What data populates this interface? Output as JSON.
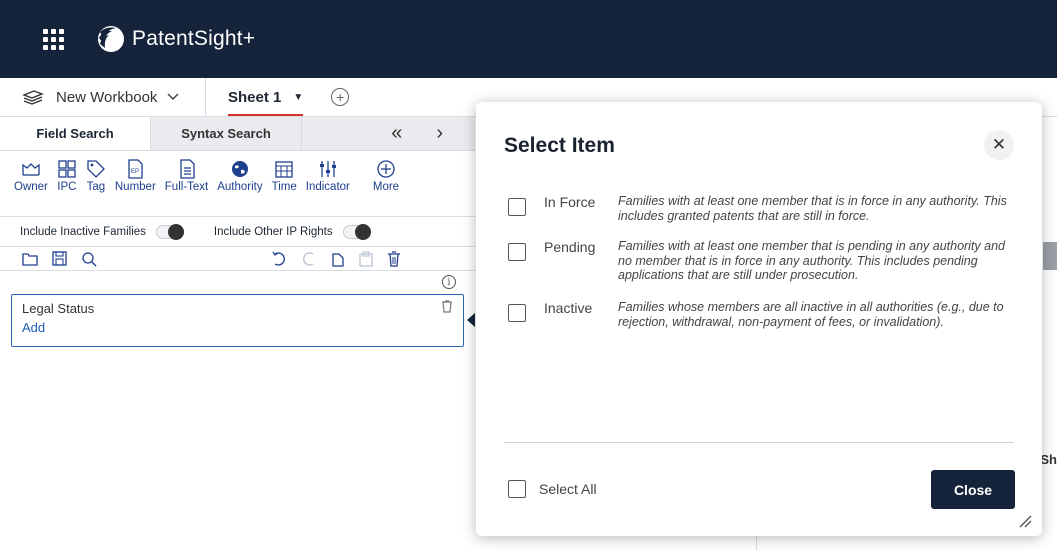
{
  "header": {
    "brand": "PatentSight+"
  },
  "workbook": {
    "name": "New Workbook",
    "sheet": "Sheet 1"
  },
  "tabs": {
    "active": "Field Search",
    "inactive": "Syntax Search"
  },
  "icons": [
    {
      "label": "Owner",
      "icon": "owner-icon"
    },
    {
      "label": "IPC",
      "icon": "ipc-icon"
    },
    {
      "label": "Tag",
      "icon": "tag-icon"
    },
    {
      "label": "Number",
      "icon": "number-icon"
    },
    {
      "label": "Full-Text",
      "icon": "fulltext-icon"
    },
    {
      "label": "Authority",
      "icon": "globe-icon"
    },
    {
      "label": "Time",
      "icon": "calendar-icon"
    },
    {
      "label": "Indicator",
      "icon": "indicator-icon"
    },
    {
      "label": "More",
      "icon": "plus-circle-icon"
    }
  ],
  "number_badge": "EP",
  "toggles": {
    "inactive": "Include Inactive Families",
    "other_ip": "Include Other IP Rights"
  },
  "legal": {
    "title": "Legal Status",
    "add": "Add"
  },
  "info_glyph": "i",
  "background": {
    "label": "Sh"
  },
  "modal": {
    "title": "Select Item",
    "options": [
      {
        "label": "In Force",
        "desc": "Families with at least one member that is in force in any authority. This includes granted patents that are still in force."
      },
      {
        "label": "Pending",
        "desc": "Families with at least one member that is pending in any authority and no member that is in force in any authority. This includes pending applications that are still under prosecution."
      },
      {
        "label": "Inactive",
        "desc": "Families whose members are all inactive in all authorities (e.g., due to rejection, withdrawal, non-payment of fees, or invalidation)."
      }
    ],
    "select_all": "Select All",
    "close": "Close"
  },
  "colors": {
    "header": "#15243a",
    "accent_red": "#d9302c",
    "link_blue": "#1f5fb8"
  }
}
